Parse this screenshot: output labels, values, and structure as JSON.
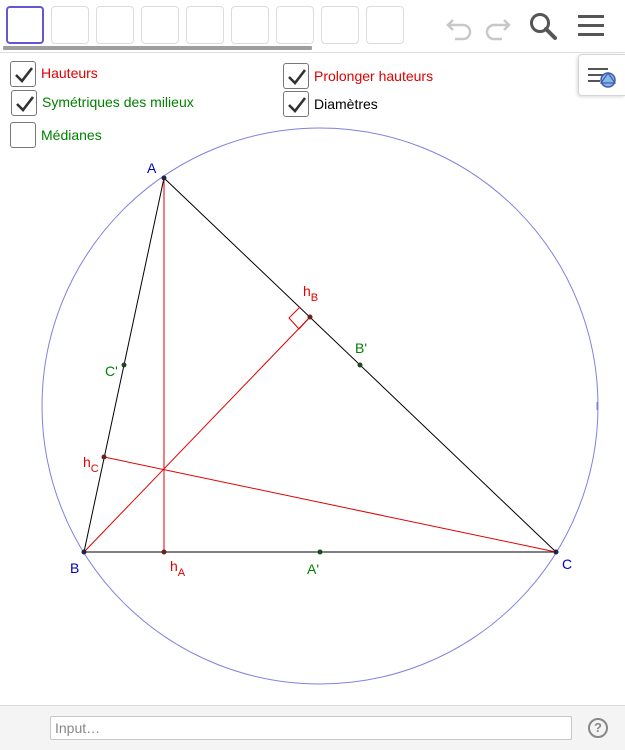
{
  "toolbar": {
    "tool_count": 9,
    "selected_tool": 0,
    "icons": [
      "undo-icon",
      "redo-icon",
      "search-icon",
      "menu-icon"
    ]
  },
  "checkboxes": [
    {
      "id": "hauteurs",
      "label": "Hauteurs",
      "checked": true,
      "color": "#e00000"
    },
    {
      "id": "symetriques",
      "label": "Symétriques des milieux",
      "checked": true,
      "color": "#008000"
    },
    {
      "id": "medianes",
      "label": "Médianes",
      "checked": false,
      "color": "#008000"
    },
    {
      "id": "prolonger",
      "label": "Prolonger hauteurs",
      "checked": true,
      "color": "#e00000"
    },
    {
      "id": "diametres",
      "label": "Diamètres",
      "checked": true,
      "color": "#000000"
    }
  ],
  "geometry": {
    "points": {
      "A": {
        "label": "A",
        "color": "#0000c0"
      },
      "B": {
        "label": "B",
        "color": "#0000c0"
      },
      "C": {
        "label": "C",
        "color": "#0000c0"
      },
      "hA": {
        "label": "h",
        "sub": "A",
        "color": "#e00000"
      },
      "hB": {
        "label": "h",
        "sub": "B",
        "color": "#e00000"
      },
      "hC": {
        "label": "h",
        "sub": "C",
        "color": "#e00000"
      },
      "Ap": {
        "label": "A'",
        "color": "#008000"
      },
      "Bp": {
        "label": "B'",
        "color": "#008000"
      },
      "Cp": {
        "label": "C'",
        "color": "#008000"
      }
    },
    "colors": {
      "triangle": "#000000",
      "altitude": "#e00000",
      "circle": "#8080e0",
      "point": "#222244"
    }
  },
  "input_bar": {
    "placeholder": "Input…",
    "help": "?"
  }
}
